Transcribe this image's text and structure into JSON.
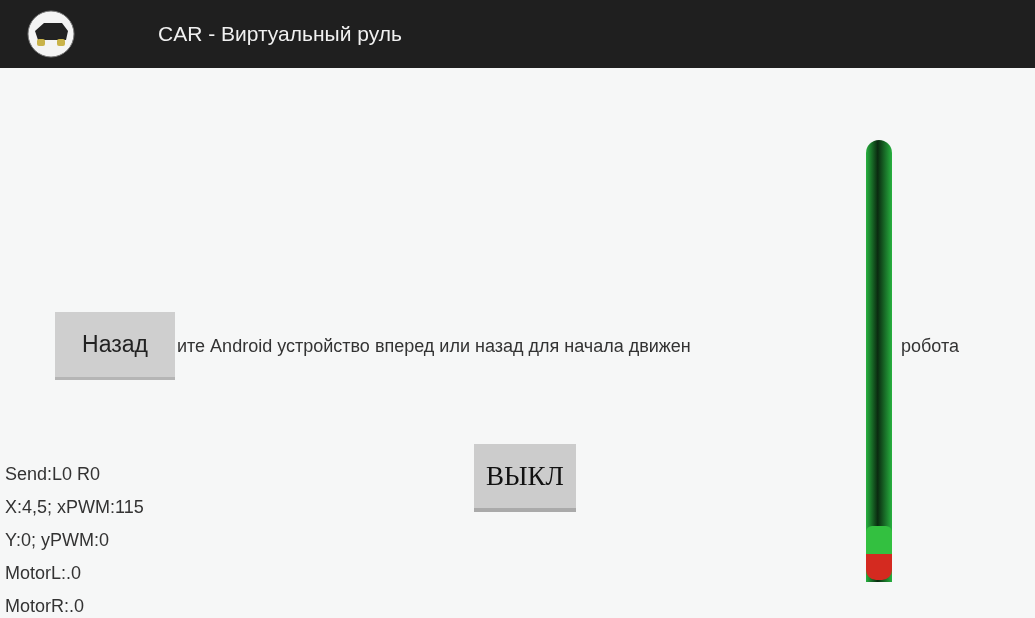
{
  "app_bar": {
    "title": "CAR - Виртуальный руль"
  },
  "back_button": {
    "label": "Назад"
  },
  "instruction": {
    "before_bar": "ите Android устройство вперед или назад для начала движен",
    "after_bar": "робота"
  },
  "off_button": {
    "label": "ВЫКЛ"
  },
  "status_lines": [
    "Send:L0 R0",
    "X:4,5; xPWM:115",
    "Y:0; yPWM:0",
    "MotorL:.0",
    "MotorR:.0"
  ]
}
